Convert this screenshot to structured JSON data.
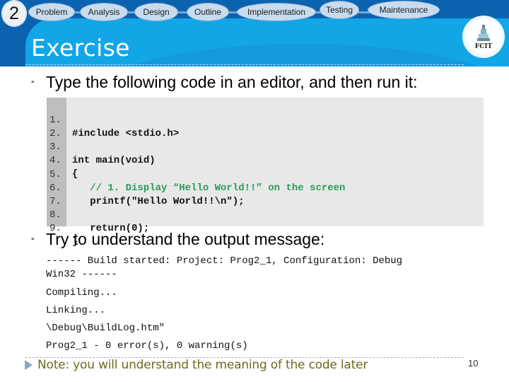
{
  "header": {
    "slide_number": "2",
    "steps": [
      "Problem",
      "Analysis",
      "Design",
      "Outline",
      "Implementation",
      "Testing",
      "Maintenance"
    ],
    "logo_text": "FCIT",
    "title": "Exercise"
  },
  "colors": {
    "header_dark": "#0b63b0",
    "header_light": "#12a6e6",
    "code_background": "#e8e8e8",
    "code_gutter": "#bdbdbd",
    "comment": "#2e9a5c",
    "note": "#6b6b1e"
  },
  "bullets": [
    "Type the following code in an editor, and then run it:",
    "Try to understand the output message:"
  ],
  "code": {
    "lines": [
      {
        "num": "1.",
        "text": "#include <stdio.h>"
      },
      {
        "num": "2.",
        "text": ""
      },
      {
        "num": "3.",
        "text": "int main(void)"
      },
      {
        "num": "4.",
        "text": "{"
      },
      {
        "num": "5.",
        "text": "   // 1. Display “Hello World!!” on the screen"
      },
      {
        "num": "6.",
        "text": "   printf(\"Hello World!!\\n\");"
      },
      {
        "num": "7.",
        "text": ""
      },
      {
        "num": "8.",
        "text": "   return(0);"
      },
      {
        "num": "9.",
        "text": "}"
      }
    ]
  },
  "output": {
    "lines": [
      "------ Build started: Project: Prog2_1, Configuration: Debug",
      "Win32 ------",
      "Compiling...",
      "Linking...",
      "\\Debug\\BuildLog.htm\"",
      "Prog2_1 - 0 error(s), 0 warning(s)"
    ]
  },
  "footer": {
    "note": "Note: you will understand the meaning of the code later",
    "page_number": "10"
  }
}
